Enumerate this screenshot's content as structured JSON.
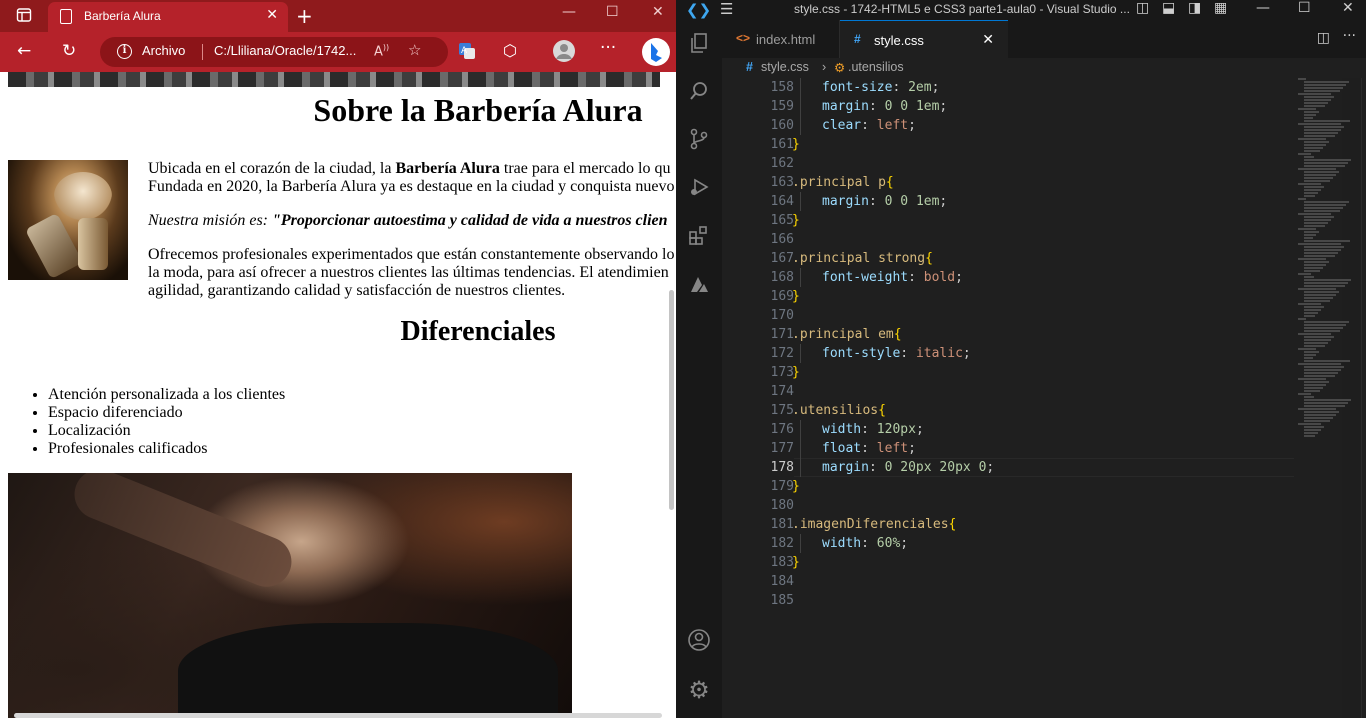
{
  "browser": {
    "tab_title": "Barbería Alura",
    "address_protocol": "Archivo",
    "address_url": "C:/Lliliana/Oracle/1742...",
    "page": {
      "heading": "Sobre la Barbería Alura",
      "p1_line1_pre": "Ubicada en el corazón de la ciudad, la ",
      "p1_line1_bold": "Barbería Alura",
      "p1_line1_post": " trae para el mercado lo qu",
      "p1_line2": "Fundada en 2020, la Barbería Alura ya es destaque en la ciudad y conquista nuevo",
      "mission_prefix": "Nuestra misión es:",
      "mission_text": " \"Proporcionar autoestima y calidad de vida a nuestros clien",
      "p3_line1": "Ofrecemos profesionales experimentados que están constantemente observando lo",
      "p3_line2": "la moda, para así ofrecer a nuestros clientes las últimas tendencias. El atendimien",
      "p3_line3": "agilidad, garantizando calidad y satisfacción de nuestros clientes.",
      "heading2": "Diferenciales",
      "diferenciales": [
        "Atención personalizada a los clientes",
        "Espacio diferenciado",
        "Localización",
        "Profesionales calificados"
      ]
    }
  },
  "vscode": {
    "window_title": "style.css - 1742-HTML5 e CSS3 parte1-aula0 - Visual Studio ...",
    "tabs": [
      {
        "label": "index.html",
        "icon": "<>",
        "active": false
      },
      {
        "label": "style.css",
        "icon": "#",
        "active": true
      }
    ],
    "breadcrumb": {
      "file": "style.css",
      "symbol": ".utensilios"
    },
    "current_line": 178,
    "code_lines": [
      {
        "n": "158",
        "t": "font-size: 2em;"
      },
      {
        "n": "159",
        "t": "margin: 0 0 1em;"
      },
      {
        "n": "160",
        "t": "clear: left;"
      },
      {
        "n": "161",
        "t": "}"
      },
      {
        "n": "162",
        "t": ""
      },
      {
        "n": "163",
        "t": ".principal p{"
      },
      {
        "n": "164",
        "t": "margin: 0 0 1em;"
      },
      {
        "n": "165",
        "t": "}"
      },
      {
        "n": "166",
        "t": ""
      },
      {
        "n": "167",
        "t": ".principal strong{"
      },
      {
        "n": "168",
        "t": "font-weight: bold;"
      },
      {
        "n": "169",
        "t": "}"
      },
      {
        "n": "170",
        "t": ""
      },
      {
        "n": "171",
        "t": ".principal em{"
      },
      {
        "n": "172",
        "t": "font-style: italic;"
      },
      {
        "n": "173",
        "t": "}"
      },
      {
        "n": "174",
        "t": ""
      },
      {
        "n": "175",
        "t": ".utensilios{"
      },
      {
        "n": "176",
        "t": "width: 120px;"
      },
      {
        "n": "177",
        "t": "float: left;"
      },
      {
        "n": "178",
        "t": "margin: 0 20px 20px 0;"
      },
      {
        "n": "179",
        "t": "}"
      },
      {
        "n": "180",
        "t": ""
      },
      {
        "n": "181",
        "t": ".imagenDiferenciales{"
      },
      {
        "n": "182",
        "t": "width: 60%;"
      },
      {
        "n": "183",
        "t": "}"
      },
      {
        "n": "184",
        "t": ""
      },
      {
        "n": "185",
        "t": ""
      }
    ]
  },
  "colors": {
    "browser_accent": "#b5222a",
    "browser_tabbar": "#8f1a1c",
    "vscode_bg": "#1f1f1f",
    "css_selector": "#d7ba7d",
    "css_property": "#9cdcfe",
    "css_value": "#ce9178",
    "css_number": "#b5cea8"
  },
  "icons": {
    "browser": [
      "sidebar-icon",
      "favicon-page-icon",
      "close-icon",
      "new-tab-icon",
      "minimize-icon",
      "maximize-icon",
      "back-icon",
      "refresh-icon",
      "info-icon",
      "read-aloud-icon",
      "favorites-icon",
      "translate-icon",
      "extensions-icon",
      "profile-icon",
      "more-icon",
      "bing-icon"
    ],
    "vscode": [
      "vscode-logo-icon",
      "menu-icon",
      "explorer-icon",
      "search-icon",
      "source-control-icon",
      "run-debug-icon",
      "extensions-icon",
      "azure-icon",
      "account-icon",
      "settings-gear-icon",
      "split-editor-icon",
      "more-icon"
    ]
  }
}
